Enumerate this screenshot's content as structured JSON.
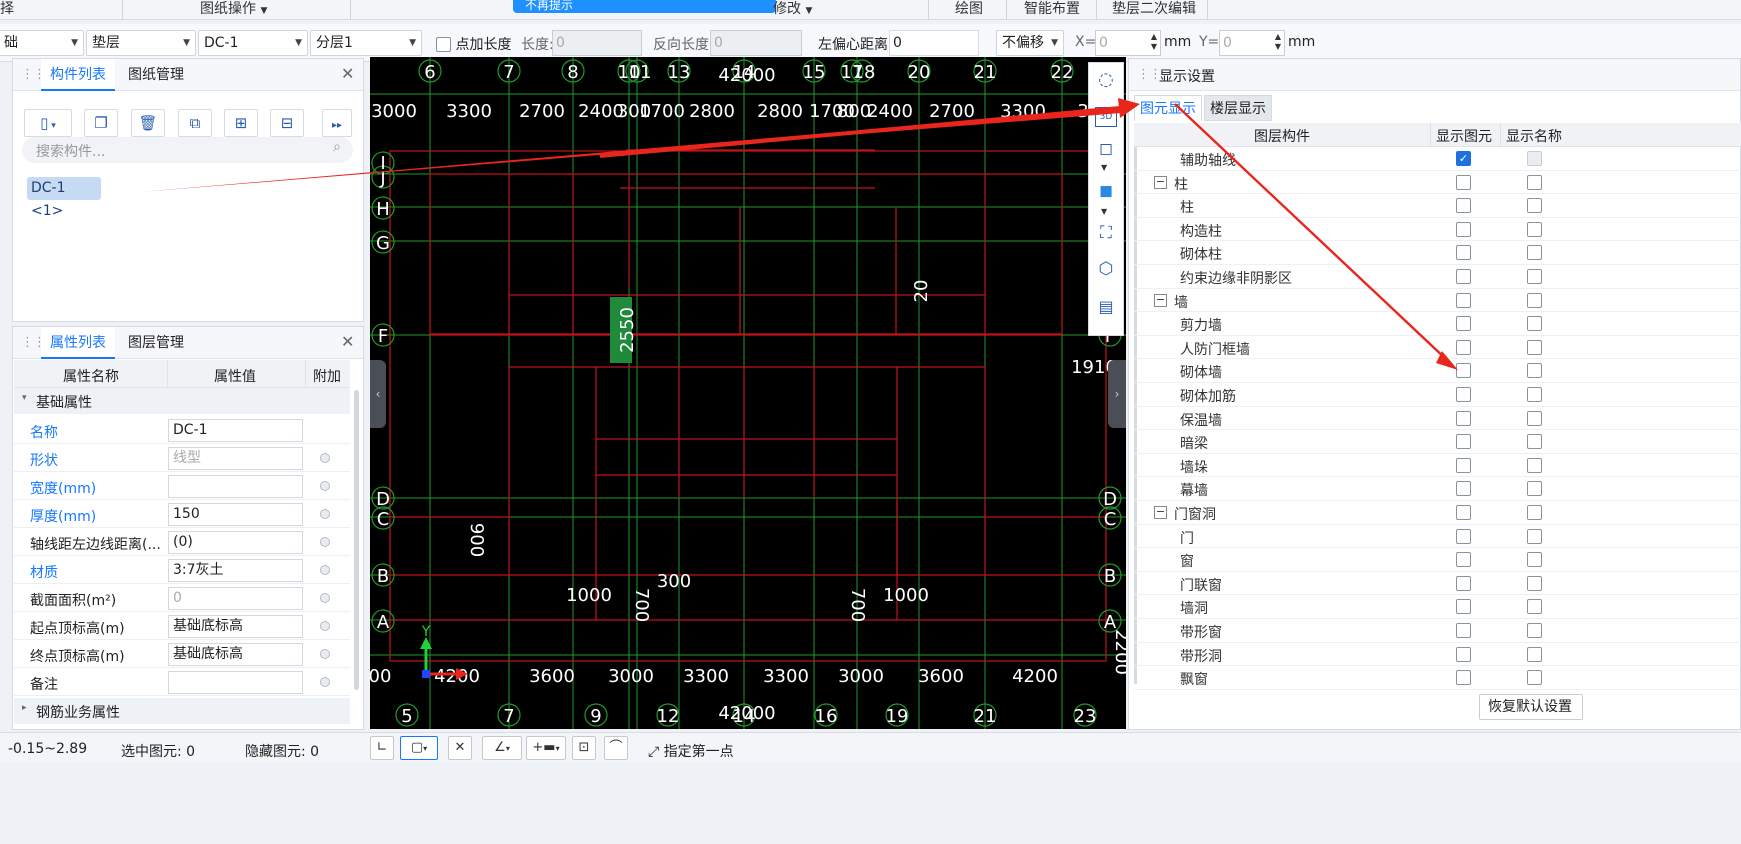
{
  "ribbon": {
    "items": [
      "择",
      "图纸操作",
      "修改",
      "绘图",
      "智能布置",
      "垫层二次编辑"
    ],
    "blue_strip_text": "不再提示"
  },
  "toolbar": {
    "combo1": "础",
    "combo2": "垫层",
    "combo3": "DC-1",
    "combo4": "分层1",
    "add_length_label": "点加长度",
    "length_label": "长度:",
    "length_value": "0",
    "reverse_length_label": "反向长度:",
    "reverse_length_value": "0",
    "left_offset_label": "左偏心距离:",
    "left_offset_value": "0",
    "offset_mode": "不偏移",
    "x_label": "X=",
    "x_value": "0",
    "x_unit": "mm",
    "y_label": "Y=",
    "y_value": "0",
    "y_unit": "mm"
  },
  "component_panel": {
    "tabs": [
      "构件列表",
      "图纸管理"
    ],
    "search_placeholder": "搜索构件...",
    "items": [
      "DC-1 <1>"
    ]
  },
  "property_panel": {
    "tabs": [
      "属性列表",
      "图层管理"
    ],
    "headers": [
      "属性名称",
      "属性值",
      "附加"
    ],
    "group_basic": "基础属性",
    "rows": [
      {
        "name": "名称",
        "value": "DC-1"
      },
      {
        "name": "形状",
        "value": "线型"
      },
      {
        "name": "宽度(mm)",
        "value": ""
      },
      {
        "name": "厚度(mm)",
        "value": "150"
      },
      {
        "name": "轴线距左边线距离(...",
        "value": "(0)"
      },
      {
        "name": "材质",
        "value": "3:7灰土"
      },
      {
        "name": "截面面积(m²)",
        "value": "0"
      },
      {
        "name": "起点顶标高(m)",
        "value": "基础底标高"
      },
      {
        "name": "终点顶标高(m)",
        "value": "基础底标高"
      },
      {
        "name": "备注",
        "value": ""
      }
    ],
    "group_rebar": "钢筋业务属性"
  },
  "cad": {
    "top_axes": [
      "6",
      "7",
      "8",
      "10",
      "11",
      "13",
      "14",
      "15",
      "17",
      "18",
      "20",
      "21",
      "22"
    ],
    "top_total": "42000",
    "top_dims": [
      "3000",
      "3300",
      "2700",
      "2400",
      "300",
      "1700",
      "2800",
      "2800",
      "1700",
      "800",
      "2400",
      "2700",
      "3300",
      "3"
    ],
    "bottom_axes": [
      "5",
      "7",
      "9",
      "12",
      "14",
      "16",
      "19",
      "21",
      "23"
    ],
    "bottom_total": "42000",
    "bottom_dims": [
      "00",
      "4200",
      "3600",
      "3000",
      "3300",
      "3300",
      "3000",
      "3600",
      "4200"
    ],
    "left_axes": [
      "I",
      "J",
      "H",
      "G",
      "F",
      "D",
      "C",
      "B",
      "A"
    ],
    "right_axes": [
      "F",
      "D",
      "C",
      "B",
      "A"
    ],
    "annotations": [
      "20",
      "2550",
      "1910",
      "900",
      "300",
      "1000",
      "700",
      "700",
      "1000",
      "2200"
    ],
    "ucs_label": "Y"
  },
  "display_panel": {
    "title": "显示设置",
    "tabs": [
      "图元显示",
      "楼层显示"
    ],
    "headers": [
      "图层构件",
      "显示图元",
      "显示名称"
    ],
    "rows": [
      {
        "label": "辅助轴线",
        "level": 2,
        "show": true,
        "name": false,
        "disabled": true
      },
      {
        "label": "柱",
        "level": 1,
        "expander": "−",
        "show": false,
        "name": false
      },
      {
        "label": "柱",
        "level": 2,
        "show": false,
        "name": false
      },
      {
        "label": "构造柱",
        "level": 2,
        "show": false,
        "name": false
      },
      {
        "label": "砌体柱",
        "level": 2,
        "show": false,
        "name": false
      },
      {
        "label": "约束边缘非阴影区",
        "level": 2,
        "show": false,
        "name": false
      },
      {
        "label": "墙",
        "level": 1,
        "expander": "−",
        "show": false,
        "name": false
      },
      {
        "label": "剪力墙",
        "level": 2,
        "show": false,
        "name": false
      },
      {
        "label": "人防门框墙",
        "level": 2,
        "show": false,
        "name": false
      },
      {
        "label": "砌体墙",
        "level": 2,
        "show": false,
        "name": false
      },
      {
        "label": "砌体加筋",
        "level": 2,
        "show": false,
        "name": false
      },
      {
        "label": "保温墙",
        "level": 2,
        "show": false,
        "name": false
      },
      {
        "label": "暗梁",
        "level": 2,
        "show": false,
        "name": false
      },
      {
        "label": "墙垛",
        "level": 2,
        "show": false,
        "name": false
      },
      {
        "label": "幕墙",
        "level": 2,
        "show": false,
        "name": false
      },
      {
        "label": "门窗洞",
        "level": 1,
        "expander": "−",
        "show": false,
        "name": false
      },
      {
        "label": "门",
        "level": 2,
        "show": false,
        "name": false
      },
      {
        "label": "窗",
        "level": 2,
        "show": false,
        "name": false
      },
      {
        "label": "门联窗",
        "level": 2,
        "show": false,
        "name": false
      },
      {
        "label": "墙洞",
        "level": 2,
        "show": false,
        "name": false
      },
      {
        "label": "带形窗",
        "level": 2,
        "show": false,
        "name": false
      },
      {
        "label": "带形洞",
        "level": 2,
        "show": false,
        "name": false
      },
      {
        "label": "飘窗",
        "level": 2,
        "show": false,
        "name": false
      }
    ],
    "restore_button": "恢复默认设置"
  },
  "statusbar": {
    "elevation": "-0.15~2.89",
    "selected": "选中图元: 0",
    "hidden": "隐藏图元: 0",
    "hint": "指定第一点"
  },
  "colors": {
    "accent": "#1677ff",
    "annotation_arrow": "#e8261c",
    "cad_bg": "#000000",
    "cad_wall": "#c0141c",
    "cad_grid": "#1f9a2a"
  }
}
